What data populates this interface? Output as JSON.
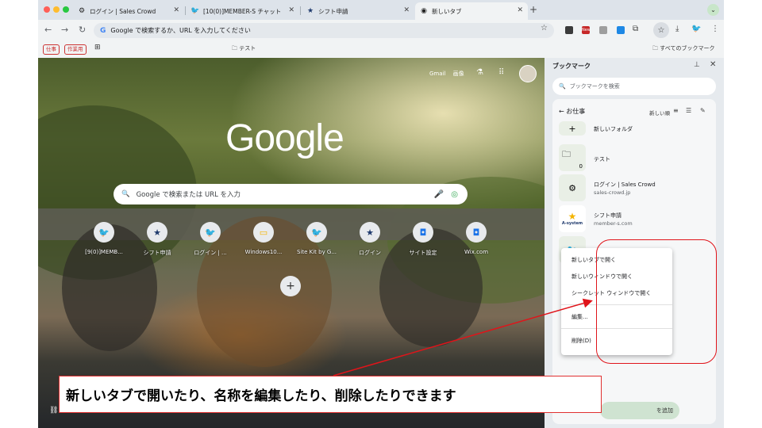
{
  "browser": {
    "tabs": [
      {
        "label": "ログイン | Sales Crowd",
        "icon": "sales-crowd-icon",
        "active": false
      },
      {
        "label": "[10(0)]MEMBER-S チャット",
        "icon": "member-s-icon",
        "active": false
      },
      {
        "label": "シフト申請",
        "icon": "star-icon",
        "active": false
      },
      {
        "label": "新しいタブ",
        "icon": "chrome-icon",
        "active": true
      }
    ],
    "new_tab_symbol": "+",
    "omnibox_placeholder": "Google で検索するか、URL を入力してください",
    "extension_badge": "New"
  },
  "bookmarks_bar": {
    "chips": [
      "仕事",
      "作業用"
    ],
    "folder": "テスト",
    "all_bookmarks": "すべてのブックマーク"
  },
  "new_tab_page": {
    "links": [
      "Gmail",
      "画像"
    ],
    "logo": "Google",
    "search_placeholder": "Google で検索または URL を入力",
    "shortcuts": [
      {
        "label": "[9(0)]MEMB...",
        "icon": "member-s-icon"
      },
      {
        "label": "シフト申請",
        "icon": "star-icon"
      },
      {
        "label": "ログイン | ...",
        "icon": "bird-icon"
      },
      {
        "label": "Windows10...",
        "icon": "slides-icon"
      },
      {
        "label": "Site Kit by G...",
        "icon": "bird-icon"
      },
      {
        "label": "ログイン",
        "icon": "star-icon"
      },
      {
        "label": "サイト設定",
        "icon": "site-icon"
      },
      {
        "label": "Wix.com",
        "icon": "site-icon"
      }
    ],
    "add_shortcut": "+"
  },
  "bookmark_panel": {
    "title": "ブックマーク",
    "search_placeholder": "ブックマークを検索",
    "folder_title": "お仕事",
    "sort_label": "新しい順",
    "items": [
      {
        "title": "新しいフォルダ",
        "subtitle": "",
        "icon": "plus-icon"
      },
      {
        "title": "テスト",
        "subtitle": "",
        "count": "0",
        "icon": "folder-icon"
      },
      {
        "title": "ログイン | Sales Crowd",
        "subtitle": "sales-crowd.jp",
        "icon": "sales-crowd-icon"
      },
      {
        "title": "シフト申請",
        "subtitle": "member-s.com",
        "icon": "a-system-icon",
        "logo_text": "A-system"
      }
    ],
    "add_button": "を追加"
  },
  "context_menu": {
    "items": [
      "新しいタブで開く",
      "新しいウィンドウで開く",
      "シークレット ウィンドウで開く",
      "編集...",
      "削除(D)"
    ]
  },
  "annotation": {
    "callout_text": "新しいタブで開いたり、名称を編集したり、削除したりできます",
    "highlight_color": "#e0141a"
  }
}
